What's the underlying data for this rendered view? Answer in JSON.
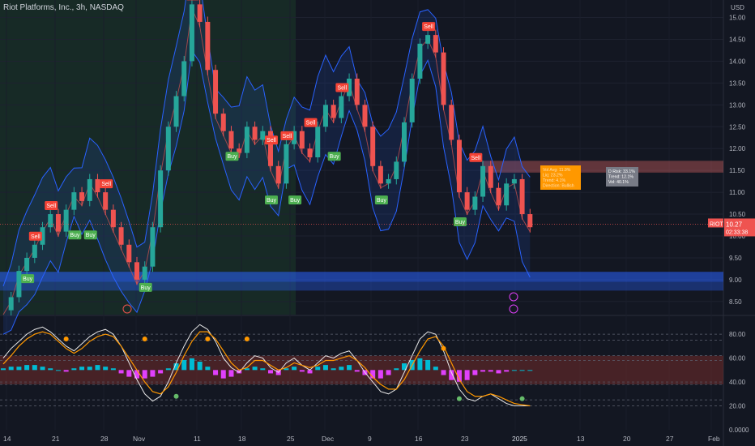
{
  "header": {
    "symbol_title": "Riot Platforms, Inc., 3h, NASDAQ"
  },
  "colors": {
    "bg": "#131722",
    "up": "#26a69a",
    "down": "#ef5350",
    "band": "#2962ff",
    "buy": "#4caf50",
    "sell": "#f44336",
    "pink": "#e040fb",
    "orange": "#ff9800",
    "teal": "#00bcd4",
    "green_zone": "#1b3a2a",
    "red_zone": "#6b2a2a"
  },
  "chart_data": [
    {
      "type": "candlestick",
      "title": "Riot Platforms, Inc., 3h, NASDAQ",
      "currency": "USD",
      "ylim": [
        8.2,
        15.4
      ],
      "y_ticks": [
        "15.00",
        "14.50",
        "14.00",
        "13.50",
        "13.00",
        "12.50",
        "12.00",
        "11.50",
        "11.00",
        "10.50",
        "10.00",
        "9.50",
        "9.00",
        "8.50"
      ],
      "x_ticks": [
        "14",
        "21",
        "28",
        "Nov",
        "11",
        "18",
        "25",
        "Dec",
        "9",
        "16",
        "23",
        "2025",
        "13",
        "20",
        "27",
        "Feb"
      ],
      "close_path": [
        8.3,
        8.6,
        9.2,
        9.5,
        9.8,
        10.2,
        10.5,
        10.1,
        10.6,
        11.0,
        10.8,
        11.3,
        11.0,
        10.6,
        10.2,
        9.8,
        9.4,
        9.0,
        9.3,
        10.2,
        11.5,
        12.5,
        13.2,
        14.0,
        15.3,
        14.9,
        13.8,
        12.8,
        12.4,
        12.0,
        11.9,
        12.5,
        12.2,
        12.4,
        11.6,
        11.2,
        12.1,
        12.4,
        12.0,
        11.8,
        12.5,
        13.0,
        12.7,
        13.2,
        13.6,
        13.0,
        12.5,
        11.6,
        11.2,
        11.3,
        11.7,
        12.6,
        13.6,
        14.4,
        14.6,
        14.2,
        13.0,
        12.2,
        11.0,
        10.6,
        10.9,
        11.6,
        11.1,
        10.7,
        11.2,
        11.3,
        10.5,
        10.2
      ],
      "current_price": {
        "symbol": "RIOT",
        "price": "10.27",
        "timer": "02:33:38"
      },
      "signals": [
        {
          "label": "Sell",
          "i": 24,
          "price": 15.3
        },
        {
          "label": "Sell",
          "i": 54,
          "price": 14.6
        },
        {
          "label": "Sell",
          "i": 43,
          "price": 13.2
        },
        {
          "label": "Sell",
          "i": 39,
          "price": 12.4
        },
        {
          "label": "Sell",
          "i": 36,
          "price": 12.1
        },
        {
          "label": "Sell",
          "i": 34,
          "price": 12.0
        },
        {
          "label": "Sell",
          "i": 13,
          "price": 11.0
        },
        {
          "label": "Sell",
          "i": 6,
          "price": 10.5
        },
        {
          "label": "Sell",
          "i": 4,
          "price": 9.8
        },
        {
          "label": "Sell",
          "i": 60,
          "price": 11.6
        },
        {
          "label": "Buy",
          "i": 18,
          "price": 9.0
        },
        {
          "label": "Buy",
          "i": 11,
          "price": 10.2
        },
        {
          "label": "Buy",
          "i": 9,
          "price": 10.2
        },
        {
          "label": "Buy",
          "i": 29,
          "price": 12.0
        },
        {
          "label": "Buy",
          "i": 34,
          "price": 11.0
        },
        {
          "label": "Buy",
          "i": 37,
          "price": 11.0
        },
        {
          "label": "Buy",
          "i": 42,
          "price": 12.0
        },
        {
          "label": "Buy",
          "i": 48,
          "price": 11.0
        },
        {
          "label": "Buy",
          "i": 58,
          "price": 10.5
        },
        {
          "label": "Buy",
          "i": 3,
          "price": 9.2
        }
      ],
      "zones": [
        {
          "name": "resistance",
          "from": 11.45,
          "to": 11.72
        },
        {
          "name": "support",
          "from": 8.95,
          "to": 9.18
        },
        {
          "name": "support-lower",
          "from": 8.75,
          "to": 8.95
        }
      ],
      "info_boxes": [
        {
          "lines": [
            "Vol Avg: 11.9%",
            "Liq: 23.2%",
            "Trend: 4.1%",
            "Direction: Bullish"
          ]
        },
        {
          "lines": [
            "D Risk: 33.1%",
            "Trend: 12.1%",
            "Vol: 40.1%"
          ]
        }
      ]
    },
    {
      "type": "oscillator",
      "ylim": [
        0,
        95
      ],
      "y_ticks": [
        "80.00",
        "60.00",
        "40.00",
        "20.00",
        "0.0000"
      ],
      "levels": [
        80,
        75,
        62,
        58,
        40,
        38,
        25,
        20
      ],
      "line_a": [
        60,
        68,
        74,
        80,
        84,
        86,
        82,
        76,
        70,
        66,
        72,
        78,
        82,
        84,
        80,
        70,
        56,
        42,
        30,
        24,
        28,
        40,
        56,
        70,
        82,
        88,
        84,
        74,
        60,
        52,
        48,
        56,
        62,
        60,
        52,
        48,
        56,
        60,
        54,
        50,
        56,
        62,
        60,
        64,
        66,
        58,
        48,
        40,
        32,
        30,
        34,
        48,
        62,
        76,
        82,
        80,
        66,
        48,
        34,
        26,
        24,
        28,
        30,
        26,
        22,
        20,
        20,
        20
      ],
      "line_b": [
        55,
        62,
        70,
        76,
        80,
        82,
        80,
        74,
        68,
        64,
        68,
        74,
        78,
        80,
        78,
        70,
        60,
        50,
        40,
        32,
        30,
        36,
        48,
        62,
        74,
        82,
        82,
        76,
        66,
        56,
        50,
        52,
        58,
        58,
        54,
        50,
        52,
        56,
        54,
        52,
        54,
        58,
        58,
        60,
        62,
        58,
        52,
        44,
        38,
        34,
        34,
        42,
        54,
        66,
        76,
        78,
        70,
        56,
        42,
        32,
        28,
        28,
        30,
        28,
        25,
        22,
        21,
        20
      ],
      "histogram": [
        1,
        2,
        2,
        3,
        3,
        2,
        1,
        0,
        -1,
        1,
        2,
        2,
        3,
        2,
        1,
        -2,
        -4,
        -5,
        -5,
        -4,
        -2,
        1,
        4,
        6,
        7,
        5,
        2,
        -3,
        -5,
        -4,
        -2,
        1,
        2,
        1,
        -2,
        -3,
        1,
        2,
        -1,
        -2,
        2,
        3,
        1,
        2,
        3,
        -1,
        -3,
        -5,
        -5,
        -3,
        1,
        4,
        6,
        7,
        6,
        2,
        -3,
        -6,
        -7,
        -6,
        -3,
        -1,
        -1,
        -2,
        -1,
        0,
        0,
        0
      ],
      "markers_orange": [
        {
          "i": 8,
          "v": 76
        },
        {
          "i": 18,
          "v": 76
        },
        {
          "i": 26,
          "v": 76
        },
        {
          "i": 31,
          "v": 76
        },
        {
          "i": 56,
          "v": 68
        }
      ],
      "markers_green": [
        {
          "i": 22,
          "v": 28
        },
        {
          "i": 58,
          "v": 26
        },
        {
          "i": 66,
          "v": 26
        }
      ]
    }
  ]
}
